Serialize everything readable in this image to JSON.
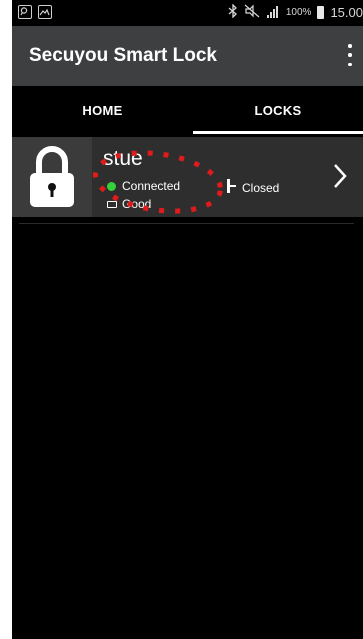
{
  "status_bar": {
    "battery_percent": "100%",
    "time": "15.00",
    "icons": [
      "search-icon",
      "image-icon",
      "bluetooth-icon",
      "mute-icon",
      "signal-icon",
      "battery-icon"
    ]
  },
  "app_bar": {
    "title": "Secuyou Smart Lock",
    "menu_icon": "more-vert-icon"
  },
  "tabs": [
    {
      "label": "HOME",
      "selected": false
    },
    {
      "label": "LOCKS",
      "selected": true
    }
  ],
  "lock_card": {
    "name": "stue",
    "connection": "Connected",
    "battery": "Good",
    "door_state": "Closed",
    "colors": {
      "connected_dot": "#37d03b",
      "card_bg": "#2e2e2e",
      "annotation": "#e11b1b"
    }
  }
}
